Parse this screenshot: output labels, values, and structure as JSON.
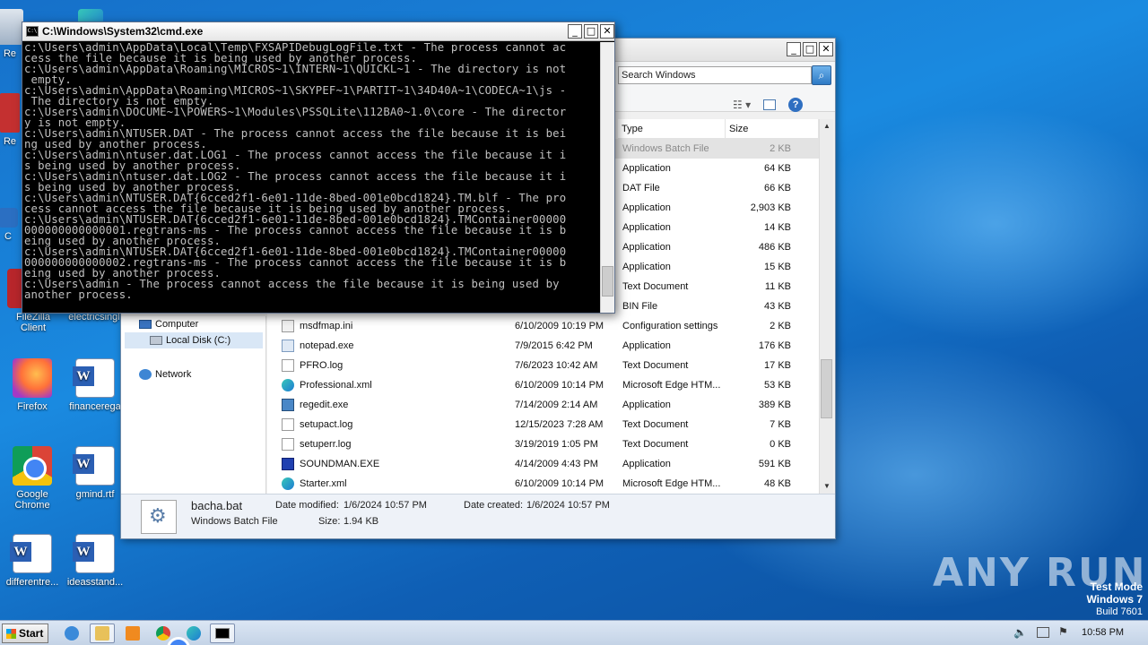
{
  "desktop": {
    "icons": [
      {
        "label": "Re"
      },
      {
        "label": "Re"
      },
      {
        "label": "C"
      },
      {
        "label": "FileZilla Client"
      },
      {
        "label": "electricsingl"
      },
      {
        "label": "Firefox"
      },
      {
        "label": "financerega"
      },
      {
        "label": "Google Chrome"
      },
      {
        "label": "gmind.rtf"
      },
      {
        "label": "differentre..."
      },
      {
        "label": "ideasstand..."
      }
    ]
  },
  "cmd": {
    "title": "C:\\Windows\\System32\\cmd.exe",
    "lines": [
      "c:\\Users\\admin\\AppData\\Local\\Temp\\FXSAPIDebugLogFile.txt - The process cannot ac",
      "cess the file because it is being used by another process.",
      "c:\\Users\\admin\\AppData\\Roaming\\MICROS~1\\INTERN~1\\QUICKL~1 - The directory is not",
      " empty.",
      "c:\\Users\\admin\\AppData\\Roaming\\MICROS~1\\SKYPEF~1\\PARTIT~1\\34D40A~1\\CODECA~1\\js -",
      " The directory is not empty.",
      "c:\\Users\\admin\\DOCUME~1\\POWERS~1\\Modules\\PSSQLite\\112BA0~1.0\\core - The director",
      "y is not empty.",
      "c:\\Users\\admin\\NTUSER.DAT - The process cannot access the file because it is bei",
      "ng used by another process.",
      "c:\\Users\\admin\\ntuser.dat.LOG1 - The process cannot access the file because it i",
      "s being used by another process.",
      "c:\\Users\\admin\\ntuser.dat.LOG2 - The process cannot access the file because it i",
      "s being used by another process.",
      "c:\\Users\\admin\\NTUSER.DAT{6cced2f1-6e01-11de-8bed-001e0bcd1824}.TM.blf - The pro",
      "cess cannot access the file because it is being used by another process.",
      "c:\\Users\\admin\\NTUSER.DAT{6cced2f1-6e01-11de-8bed-001e0bcd1824}.TMContainer00000",
      "000000000000001.regtrans-ms - The process cannot access the file because it is b",
      "eing used by another process.",
      "c:\\Users\\admin\\NTUSER.DAT{6cced2f1-6e01-11de-8bed-001e0bcd1824}.TMContainer00000",
      "000000000000002.regtrans-ms - The process cannot access the file because it is b",
      "eing used by another process.",
      "c:\\Users\\admin - The process cannot access the file because it is being used by",
      "another process."
    ]
  },
  "explorer": {
    "search_placeholder": "Search Windows",
    "columns": {
      "type": "Type",
      "size": "Size"
    },
    "nav": {
      "computer": "Computer",
      "local_disk": "Local Disk (C:)",
      "network": "Network"
    },
    "files_partial": [
      {
        "type": "Windows Batch File",
        "size": "2 KB"
      },
      {
        "type": "Application",
        "size": "64 KB"
      },
      {
        "type": "DAT File",
        "size": "66 KB"
      },
      {
        "type": "Application",
        "size": "2,903 KB"
      },
      {
        "type": "Application",
        "size": "14 KB"
      },
      {
        "type": "Application",
        "size": "486 KB"
      },
      {
        "type": "Application",
        "size": "15 KB"
      },
      {
        "type": "Text Document",
        "size": "11 KB"
      },
      {
        "type": "BIN File",
        "size": "43 KB"
      }
    ],
    "files": [
      {
        "name": "msdfmap.ini",
        "date": "6/10/2009 10:19 PM",
        "type": "Configuration settings",
        "size": "2 KB",
        "icon": "cfg"
      },
      {
        "name": "notepad.exe",
        "date": "7/9/2015 6:42 PM",
        "type": "Application",
        "size": "176 KB",
        "icon": "app"
      },
      {
        "name": "PFRO.log",
        "date": "7/6/2023 10:42 AM",
        "type": "Text Document",
        "size": "17 KB",
        "icon": "txt"
      },
      {
        "name": "Professional.xml",
        "date": "6/10/2009 10:14 PM",
        "type": "Microsoft Edge HTM...",
        "size": "53 KB",
        "icon": "edge"
      },
      {
        "name": "regedit.exe",
        "date": "7/14/2009 2:14 AM",
        "type": "Application",
        "size": "389 KB",
        "icon": "reg"
      },
      {
        "name": "setupact.log",
        "date": "12/15/2023 7:28 AM",
        "type": "Text Document",
        "size": "7 KB",
        "icon": "txt"
      },
      {
        "name": "setuperr.log",
        "date": "3/19/2019 1:05 PM",
        "type": "Text Document",
        "size": "0 KB",
        "icon": "txt"
      },
      {
        "name": "SOUNDMAN.EXE",
        "date": "4/14/2009 4:43 PM",
        "type": "Application",
        "size": "591 KB",
        "icon": "snd"
      },
      {
        "name": "Starter.xml",
        "date": "6/10/2009 10:14 PM",
        "type": "Microsoft Edge HTM...",
        "size": "48 KB",
        "icon": "edge"
      }
    ],
    "details": {
      "file_name": "bacha.bat",
      "file_type": "Windows Batch File",
      "modified_label": "Date modified:",
      "modified_value": "1/6/2024 10:57 PM",
      "created_label": "Date created:",
      "created_value": "1/6/2024 10:57 PM",
      "size_label": "Size:",
      "size_value": "1.94 KB"
    }
  },
  "taskbar": {
    "start_label": "Start",
    "time": "10:58 PM"
  },
  "watermark": "ANY RUN",
  "testmode": {
    "line1": "Test Mode",
    "line2": "Windows 7",
    "line3": "Build 7601"
  }
}
